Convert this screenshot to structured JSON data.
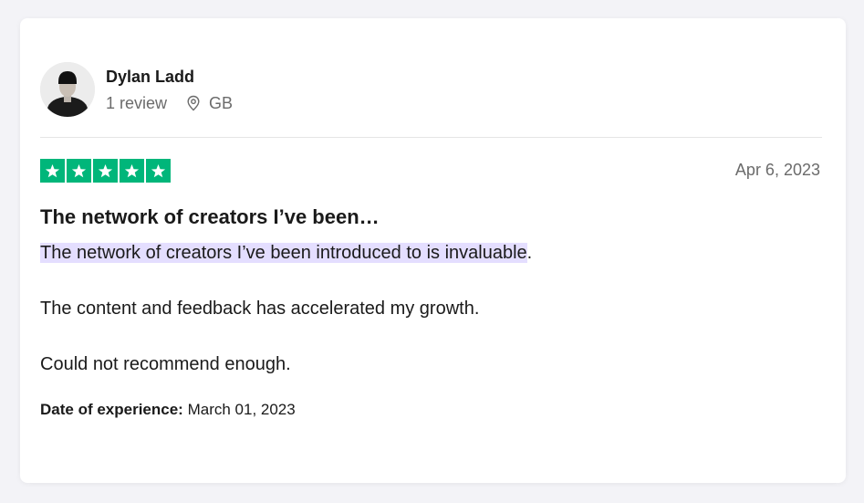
{
  "review": {
    "reviewer_name": "Dylan Ladd",
    "review_count": "1 review",
    "country": "GB",
    "rating": 5,
    "rating_max": 5,
    "star_color": "#00b67a",
    "date": "Apr 6, 2023",
    "title": "The network of creators I’ve been…",
    "body_highlighted": "The network of creators I’ve been introduced to is invaluable",
    "body_highlight_end": ".",
    "body_paragraph_2": "The content and feedback has accelerated my growth.",
    "body_paragraph_3": "Could not recommend enough.",
    "experience_label": "Date of experience:",
    "experience_date": "March 01, 2023",
    "highlight_color": "#e4deff"
  },
  "icons": {
    "avatar": "user-avatar-photo",
    "location": "location-pin-icon",
    "star": "star-icon"
  }
}
